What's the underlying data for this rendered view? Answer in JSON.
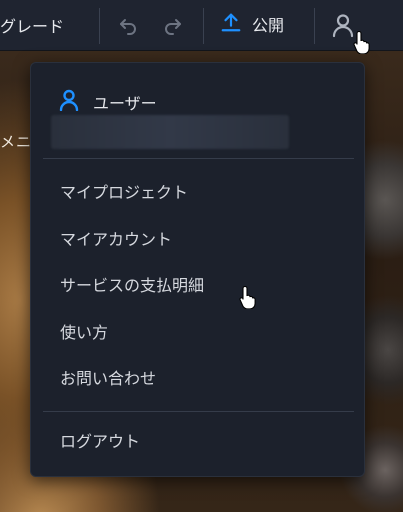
{
  "toolbar": {
    "upgrade_label": "グレード",
    "publish_label": "公開"
  },
  "background": {
    "partial_text": "メニ"
  },
  "menu": {
    "user_label": "ユーザー",
    "items": [
      {
        "label": "マイプロジェクト"
      },
      {
        "label": "マイアカウント"
      },
      {
        "label": "サービスの支払明細"
      },
      {
        "label": "使い方"
      },
      {
        "label": "お問い合わせ"
      }
    ],
    "logout_label": "ログアウト"
  },
  "colors": {
    "toolbar_bg": "#1f2430",
    "menu_bg": "#1c212c",
    "accent_blue": "#1e90ff",
    "text": "#d6d9df"
  },
  "icons": [
    "undo-icon",
    "redo-icon",
    "upload-icon",
    "user-icon",
    "hand-cursor-icon"
  ]
}
